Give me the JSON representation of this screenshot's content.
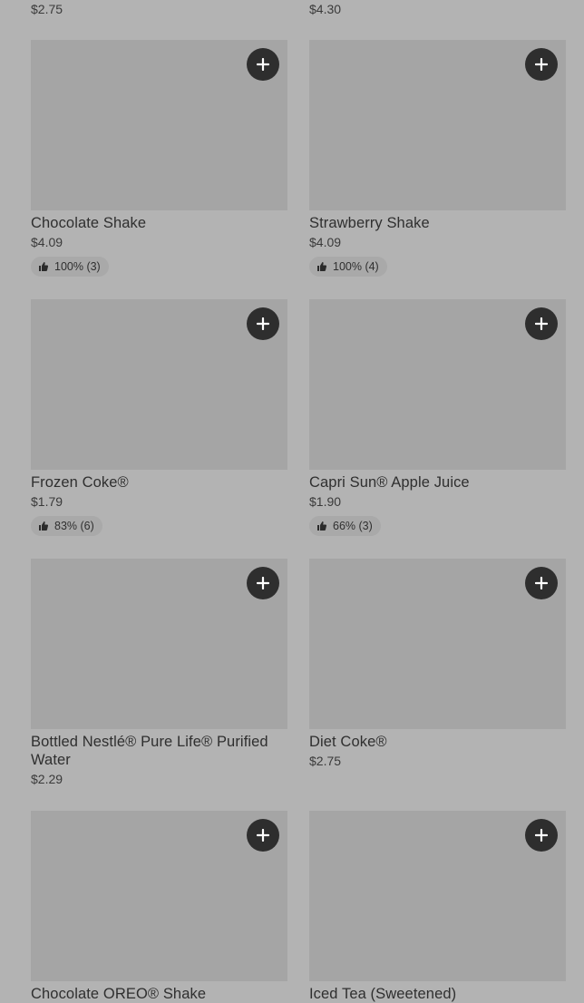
{
  "top_prices": [
    "$2.75",
    "$4.30"
  ],
  "items": [
    {
      "name": "Chocolate Shake",
      "price": "$4.09",
      "rating": "100% (3)"
    },
    {
      "name": "Strawberry Shake",
      "price": "$4.09",
      "rating": "100% (4)"
    },
    {
      "name": "Frozen Coke®",
      "price": "$1.79",
      "rating": "83% (6)"
    },
    {
      "name": "Capri Sun® Apple Juice",
      "price": "$1.90",
      "rating": "66% (3)"
    },
    {
      "name": "Bottled Nestlé® Pure Life® Purified Water",
      "price": "$2.29",
      "rating": null
    },
    {
      "name": "Diet Coke®",
      "price": "$2.75",
      "rating": null
    },
    {
      "name": "Chocolate OREO® Shake",
      "price": null,
      "rating": null
    },
    {
      "name": "Iced Tea (Sweetened)",
      "price": null,
      "rating": null
    }
  ],
  "icons": {
    "add": "plus-icon",
    "rating": "thumbs-up-icon"
  }
}
